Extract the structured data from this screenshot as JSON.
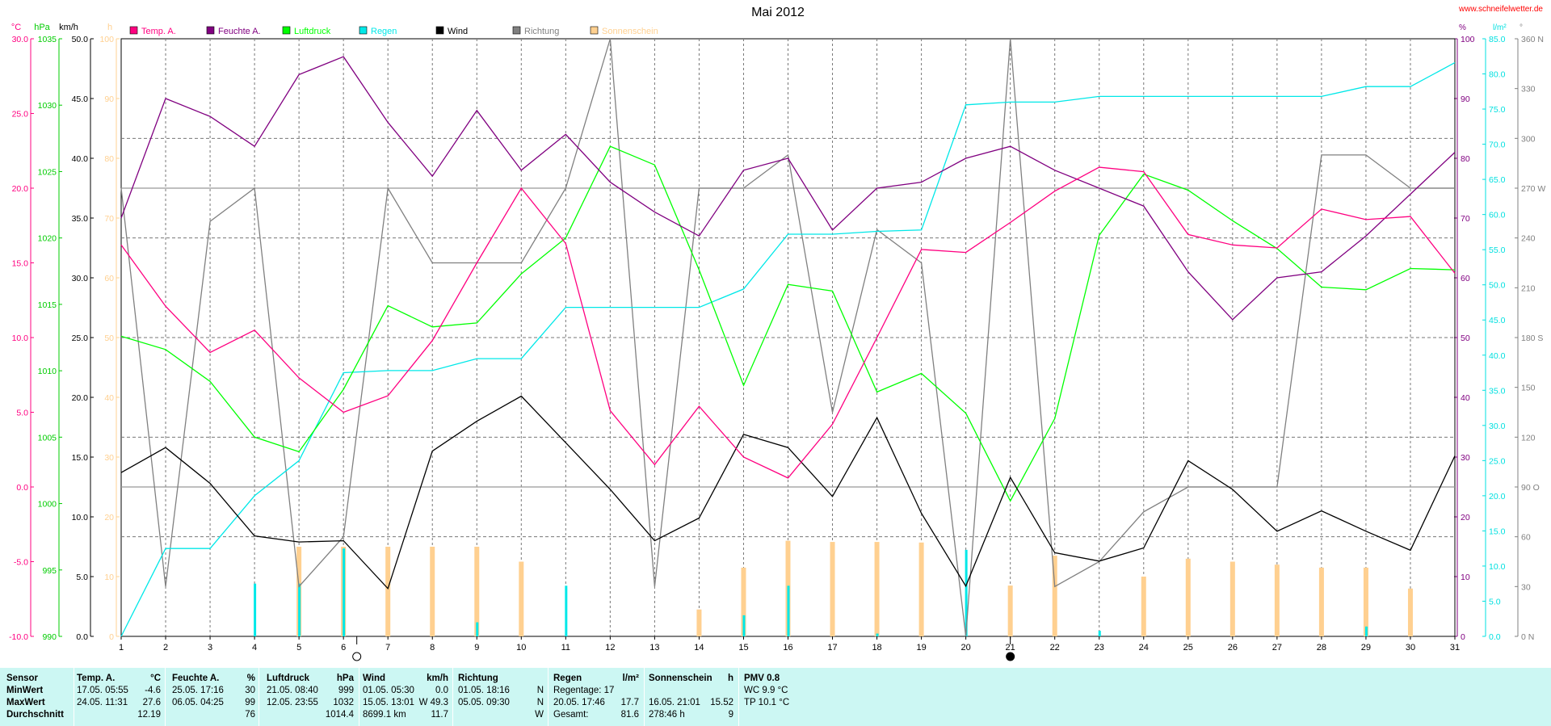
{
  "chart_data": {
    "type": "line",
    "title": "Mai 2012",
    "source": "www.schneifelwetter.de",
    "x": [
      1,
      2,
      3,
      4,
      5,
      6,
      7,
      8,
      9,
      10,
      11,
      12,
      13,
      14,
      15,
      16,
      17,
      18,
      19,
      20,
      21,
      22,
      23,
      24,
      25,
      26,
      27,
      28,
      29,
      30,
      31
    ],
    "xlim": [
      1,
      31
    ],
    "moon_phases": [
      {
        "day": 6.3,
        "phase": "full"
      },
      {
        "day": 21.0,
        "phase": "new"
      }
    ],
    "axes": {
      "temp": {
        "unit": "°C",
        "color": "#ff0080",
        "min": -10,
        "max": 30,
        "step": 5,
        "ticks": [
          "30.0",
          "25.0",
          "20.0",
          "15.0",
          "10.0",
          "5.0",
          "0.0",
          "-5.0",
          "-10.0"
        ]
      },
      "pressure": {
        "unit": "hPa",
        "color": "#00cc00",
        "min": 990,
        "max": 1035,
        "step": 5,
        "ticks": [
          "1035",
          "1030",
          "1025",
          "1020",
          "1015",
          "1010",
          "1005",
          "1000",
          "995",
          "990"
        ]
      },
      "wind": {
        "unit": "km/h",
        "color": "#000000",
        "min": 0,
        "max": 50,
        "step": 5,
        "ticks": [
          "50.0",
          "45.0",
          "40.0",
          "35.0",
          "30.0",
          "25.0",
          "20.0",
          "15.0",
          "10.0",
          "5.0",
          "0.0"
        ]
      },
      "sun": {
        "unit": "h",
        "color": "#ffd090",
        "min": 0,
        "max": 100,
        "step": 10,
        "ticks": [
          "100",
          "90",
          "80",
          "70",
          "60",
          "50",
          "40",
          "30",
          "20",
          "10",
          "0"
        ]
      },
      "humidity": {
        "unit": "%",
        "color": "#800080",
        "min": 0,
        "max": 100,
        "step": 10,
        "ticks": [
          "100",
          "90",
          "80",
          "70",
          "60",
          "50",
          "40",
          "30",
          "20",
          "10",
          "0"
        ]
      },
      "rain": {
        "unit": "l/m²",
        "color": "#00e0e0",
        "min": 0,
        "max": 85,
        "step": 5,
        "ticks": [
          "85.0",
          "80.0",
          "75.0",
          "70.0",
          "65.0",
          "60.0",
          "55.0",
          "50.0",
          "45.0",
          "40.0",
          "35.0",
          "30.0",
          "25.0",
          "20.0",
          "15.0",
          "10.0",
          "5.0",
          "0.0"
        ]
      },
      "direction": {
        "unit": "°",
        "color": "#808080",
        "min": 0,
        "max": 360,
        "step": 30,
        "ticks": [
          "360 N",
          "330",
          "300",
          "270 W",
          "240",
          "210",
          "180 S",
          "150",
          "120",
          "90 O",
          "60",
          "30",
          "0 N"
        ]
      }
    },
    "series": [
      {
        "name": "Temp. A.",
        "key": "temp",
        "axis": "temp",
        "color": "#ff0080",
        "values": [
          16.2,
          12.1,
          9.0,
          10.5,
          7.3,
          5.0,
          6.1,
          9.8,
          15.0,
          20.0,
          16.3,
          5.1,
          1.5,
          5.4,
          2.0,
          0.6,
          4.2,
          10.0,
          15.9,
          15.7,
          17.7,
          19.8,
          21.4,
          21.1,
          16.9,
          16.2,
          16.0,
          18.6,
          17.9,
          18.1,
          14.3
        ]
      },
      {
        "name": "Feuchte A.",
        "key": "humidity",
        "axis": "humidity",
        "color": "#800080",
        "values": [
          70,
          90,
          87,
          82,
          94,
          97,
          86,
          77,
          88,
          78,
          84,
          76,
          71,
          67,
          78,
          80,
          68,
          75,
          76,
          80,
          82,
          78,
          75,
          72,
          61,
          53,
          60,
          61,
          67,
          74,
          81
        ]
      },
      {
        "name": "Luftdruck",
        "key": "pressure",
        "axis": "pressure",
        "color": "#00ff00",
        "values": [
          1012.6,
          1011.6,
          1009.2,
          1005.0,
          1003.9,
          1008.6,
          1014.9,
          1013.3,
          1013.6,
          1017.3,
          1020.0,
          1026.9,
          1025.5,
          1017.6,
          1008.9,
          1016.5,
          1016.0,
          1008.4,
          1009.8,
          1006.8,
          1000.2,
          1006.4,
          1020.2,
          1024.8,
          1023.6,
          1021.3,
          1019.2,
          1016.3,
          1016.1,
          1017.7,
          1017.6
        ]
      },
      {
        "name": "Regen",
        "key": "rain",
        "axis": "rain",
        "color": "#00e8e8",
        "values": [
          0.0,
          12.5,
          12.5,
          20.0,
          25.0,
          37.5,
          37.8,
          37.8,
          39.5,
          39.5,
          46.8,
          46.8,
          46.8,
          46.8,
          49.4,
          57.2,
          57.2,
          57.6,
          57.8,
          75.6,
          76.0,
          76.0,
          76.8,
          76.8,
          76.8,
          76.8,
          76.8,
          76.8,
          78.2,
          78.2,
          81.6
        ]
      },
      {
        "name": "Wind",
        "key": "wind",
        "axis": "wind",
        "color": "#000000",
        "values": [
          13.7,
          15.8,
          12.8,
          8.4,
          7.9,
          8.0,
          4.0,
          15.5,
          18.0,
          20.1,
          16.2,
          12.3,
          8.0,
          9.9,
          16.9,
          15.8,
          11.7,
          18.3,
          10.3,
          4.2,
          13.3,
          7.0,
          6.3,
          7.4,
          14.7,
          12.3,
          8.8,
          10.5,
          8.8,
          7.2,
          15.1
        ]
      },
      {
        "name": "Richtung",
        "key": "direction",
        "axis": "direction",
        "color": "#808080",
        "values": [
          270,
          30,
          250,
          270,
          30,
          60,
          270,
          225,
          225,
          225,
          270,
          360,
          30,
          270,
          270,
          290,
          135,
          245,
          225,
          0,
          360,
          30,
          45,
          75,
          90,
          90,
          90,
          290,
          290,
          270,
          270
        ]
      },
      {
        "name": "Sonnenschein",
        "key": "sun",
        "axis": "sun",
        "color": "#ffd090",
        "type": "bar",
        "values": [
          0,
          0,
          0,
          0,
          15,
          15,
          15,
          15,
          15,
          12.5,
          0,
          0,
          0,
          4.5,
          11.5,
          16,
          15.8,
          15.8,
          15.7,
          0,
          8.5,
          13.5,
          0,
          10,
          13,
          12.5,
          12,
          11.5,
          11.5,
          8,
          0
        ]
      }
    ],
    "bars": [
      {
        "name": "Regen (Tag)",
        "axis": "rain",
        "color": "#00e8e8",
        "values": [
          0,
          0,
          0,
          7.5,
          7.5,
          12.5,
          0,
          0,
          2,
          0,
          7.2,
          0,
          0,
          0,
          3,
          7.2,
          0,
          0.4,
          0,
          12.3,
          0,
          0,
          0.8,
          0,
          0,
          0,
          0,
          0,
          1.4,
          0,
          0
        ]
      }
    ]
  },
  "legend": [
    {
      "label": "Temp. A.",
      "color": "#ff0080"
    },
    {
      "label": "Feuchte A.",
      "color": "#800080"
    },
    {
      "label": "Luftdruck",
      "color": "#00ff00"
    },
    {
      "label": "Regen",
      "color": "#00e8e8"
    },
    {
      "label": "Wind",
      "color": "#000000"
    },
    {
      "label": "Richtung",
      "color": "#808080"
    },
    {
      "label": "Sonnenschein",
      "color": "#ffd090"
    }
  ],
  "stats": {
    "sensor": {
      "title": "Sensor",
      "min": "MinWert",
      "max": "MaxWert",
      "avg": "Durchschnitt"
    },
    "temp": {
      "title": "Temp. A.",
      "unit": "°C",
      "min_ts": "17.05.  05:55",
      "min_val": "-4.6",
      "max_ts": "24.05.  11:31",
      "max_val": "27.6",
      "avg_val": "12.19"
    },
    "humidity": {
      "title": "Feuchte A.",
      "unit": "%",
      "min_ts": "25.05.  17:16",
      "min_val": "30",
      "max_ts": "06.05.  04:25",
      "max_val": "99",
      "avg_val": "76"
    },
    "pressure": {
      "title": "Luftdruck",
      "unit": "hPa",
      "min_ts": "21.05.  08:40",
      "min_val": "999",
      "max_ts": "12.05.  23:55",
      "max_val": "1032",
      "avg_val": "1014.4"
    },
    "wind": {
      "title": "Wind",
      "unit": "km/h",
      "min_ts": "01.05.  05:30",
      "min_val": "0.0",
      "max_ts": "15.05.  13:01",
      "max_val": "W 49.3",
      "avg_ts": "8699.1 km",
      "avg_val": "11.7"
    },
    "direction": {
      "title": "Richtung",
      "min_ts": "01.05.  18:16",
      "min_val": "N",
      "max_ts": "05.05.  09:30",
      "max_val": "N",
      "avg_val": "W"
    },
    "rain": {
      "title": "Regen",
      "unit": "l/m²",
      "row1": "Regentage: 17",
      "max_ts": "20.05.  17:46",
      "max_val": "17.7",
      "total_label": "Gesamt:",
      "total_val": "81.6"
    },
    "sun": {
      "title": "Sonnenschein",
      "unit": "h",
      "max_ts": "16.05.  21:01",
      "max_val": "15.52",
      "total_ts": "278:46 h",
      "total_val": "9"
    },
    "pmv": {
      "title": "PMV 0.8",
      "wc": "WC 9.9 °C",
      "tp": "TP 10.1 °C"
    }
  }
}
